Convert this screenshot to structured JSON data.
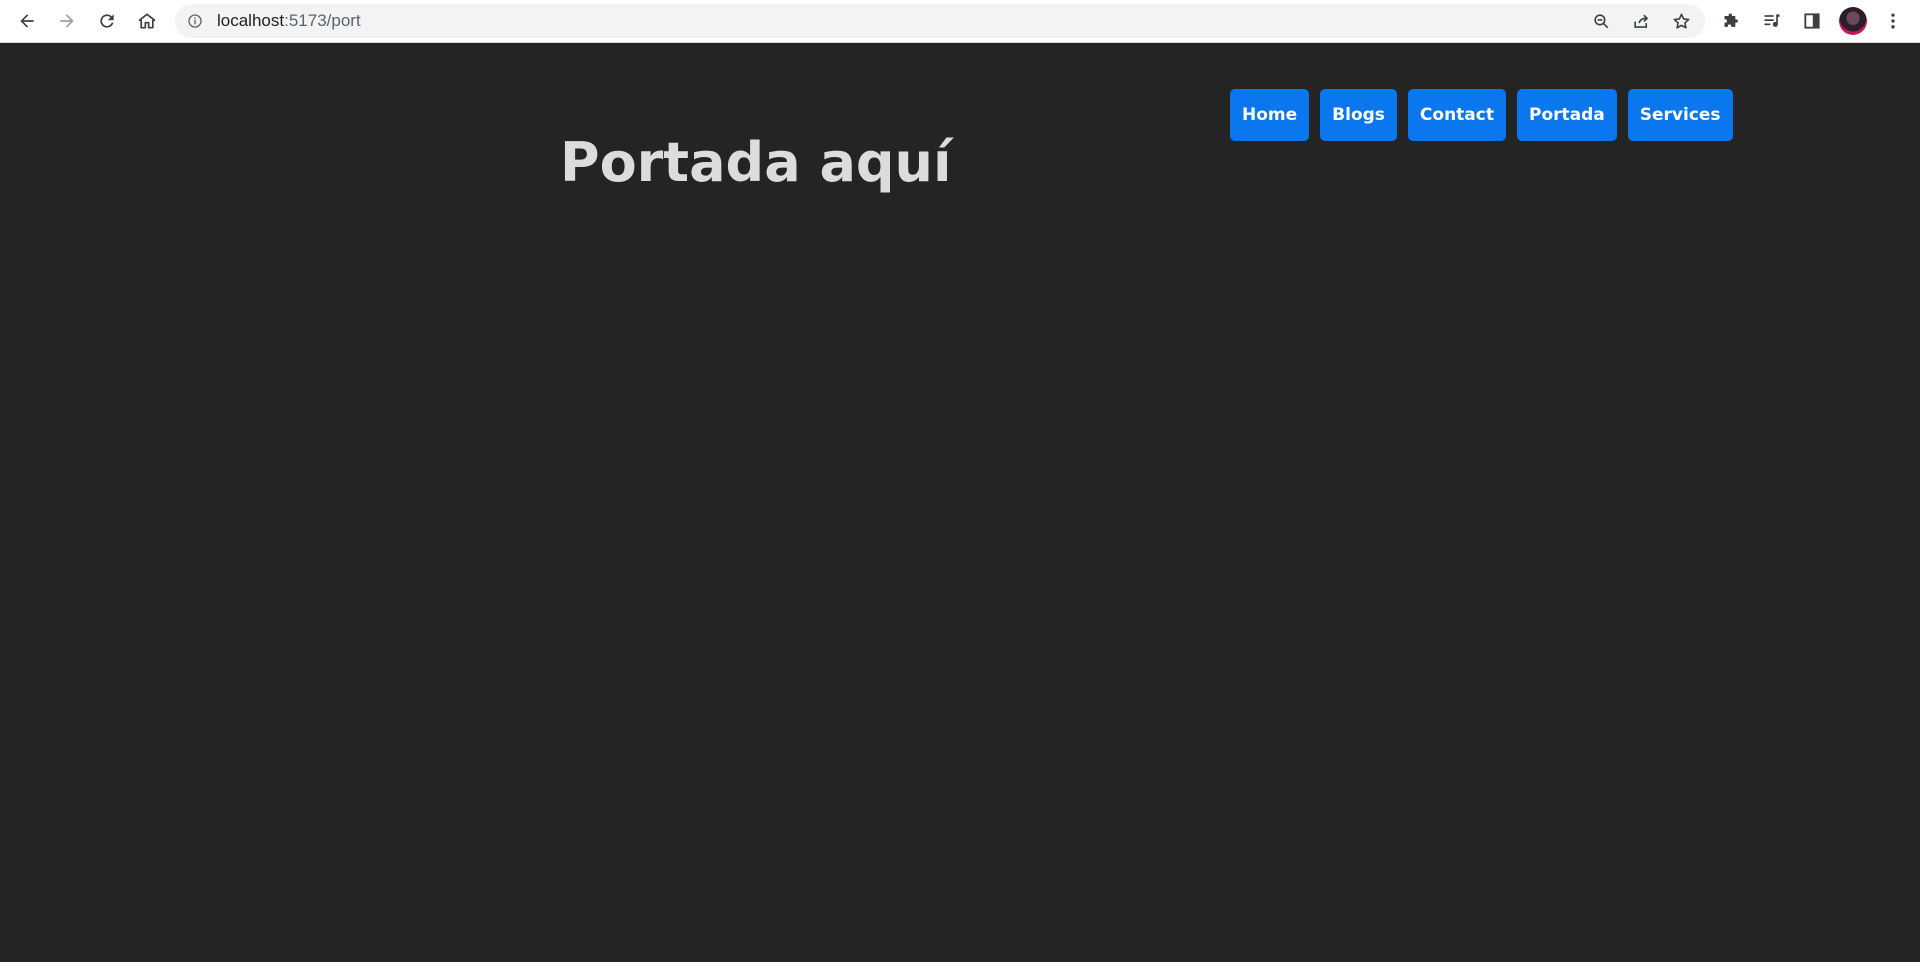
{
  "browser": {
    "url_host": "localhost",
    "url_path": ":5173/port",
    "icons": {
      "back": "arrow-left-icon",
      "forward": "arrow-right-icon",
      "reload": "reload-icon",
      "home": "home-icon",
      "site_info": "info-icon",
      "zoom": "zoom-out-icon",
      "share": "share-icon",
      "bookmark": "star-icon",
      "extensions": "puzzle-icon",
      "media": "media-control-icon",
      "side_panel": "side-panel-icon",
      "menu": "kebab-menu-icon"
    }
  },
  "page": {
    "title": "Portada aquí",
    "background": "#242424",
    "nav": {
      "accent": "#0a77ee",
      "items": [
        {
          "label": "Home"
        },
        {
          "label": "Blogs"
        },
        {
          "label": "Contact"
        },
        {
          "label": "Portada"
        },
        {
          "label": "Services"
        }
      ]
    }
  }
}
